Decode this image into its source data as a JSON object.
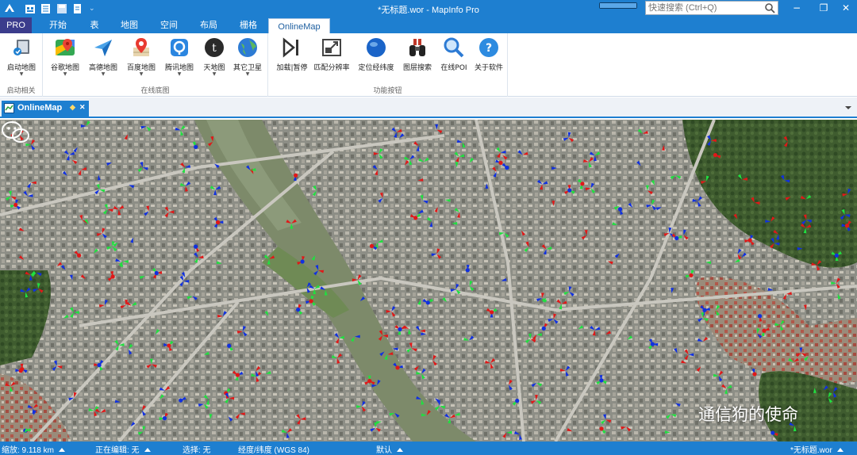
{
  "window": {
    "title": "*无标题.wor - MapInfo Pro",
    "search_placeholder": "快速搜索 (Ctrl+Q)",
    "progress": 1.0,
    "controls": {
      "minimize": "−",
      "restore": "❐",
      "close": "✕"
    }
  },
  "tabs": [
    "PRO",
    "开始",
    "表",
    "地图",
    "空间",
    "布局",
    "栅格",
    "OnlineMap"
  ],
  "active_tab": "OnlineMap",
  "ribbon": {
    "groups": [
      {
        "title": "启动相关",
        "buttons": [
          {
            "label": "启动地图",
            "icon": "launch-map-icon",
            "dropdown": true
          }
        ]
      },
      {
        "title": "在线底图",
        "buttons": [
          {
            "label": "谷歌地图",
            "icon": "google-maps-icon",
            "dropdown": true
          },
          {
            "label": "高德地图",
            "icon": "amap-icon",
            "dropdown": true
          },
          {
            "label": "百度地图",
            "icon": "baidu-map-icon",
            "dropdown": true
          },
          {
            "label": "腾讯地图",
            "icon": "tencent-map-icon",
            "dropdown": true
          },
          {
            "label": "天地图",
            "icon": "tianditu-icon",
            "dropdown": true
          },
          {
            "label": "其它卫星",
            "icon": "satellite-globe-icon",
            "dropdown": true
          }
        ]
      },
      {
        "title": "功能按钮",
        "buttons": [
          {
            "label": "加载|暂停",
            "icon": "play-pause-icon",
            "dropdown": false
          },
          {
            "label": "匹配分辨率",
            "icon": "match-resolution-icon",
            "dropdown": false
          },
          {
            "label": "定位经纬度",
            "icon": "locate-globe-icon",
            "dropdown": false
          },
          {
            "label": "图层搜索",
            "icon": "binoculars-icon",
            "dropdown": false
          },
          {
            "label": "在线POI",
            "icon": "magnifier-icon",
            "dropdown": false
          },
          {
            "label": "关于软件",
            "icon": "help-icon",
            "dropdown": false
          }
        ]
      }
    ]
  },
  "document_tab": {
    "label": "OnlineMap",
    "pin": "◆",
    "close": "✕"
  },
  "watermark": "通信狗的使命",
  "status": {
    "zoom": "缩放: 9.118 km",
    "editing": "正在编辑: 无",
    "selection": "选择: 无",
    "projection": "经度/纬度 (WGS 84)",
    "default": "默认",
    "workspace": "*无标题.wor"
  },
  "colors": {
    "accent": "#1e7fd0",
    "pro_tab": "#3b3c8c",
    "sector_blue": "#1030e0",
    "sector_green": "#20e040",
    "sector_red": "#e01818",
    "river": "#7d8a6a"
  }
}
